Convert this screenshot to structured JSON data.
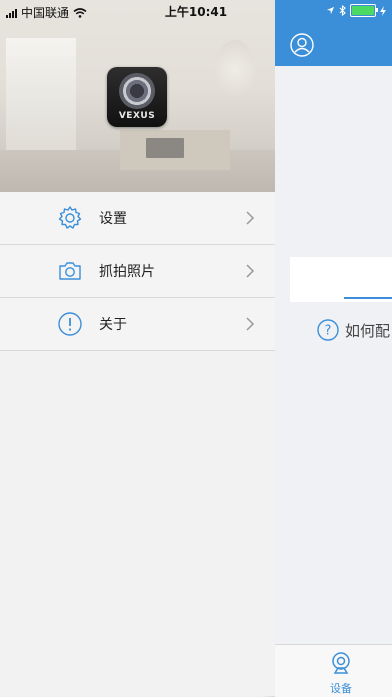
{
  "status_bar": {
    "carrier": "中国联通",
    "time": "上午10:41",
    "battery_color": "#4cd964"
  },
  "drawer": {
    "logo_text": "VEXUS",
    "menu": [
      {
        "label": "设置",
        "icon": "gear-icon"
      },
      {
        "label": "抓拍照片",
        "icon": "camera-icon"
      },
      {
        "label": "关于",
        "icon": "info-icon"
      }
    ]
  },
  "main": {
    "header_color": "#3b8fd9",
    "help_text": "如何配",
    "tabs": [
      {
        "label": "设备",
        "icon": "webcam-icon"
      }
    ]
  }
}
